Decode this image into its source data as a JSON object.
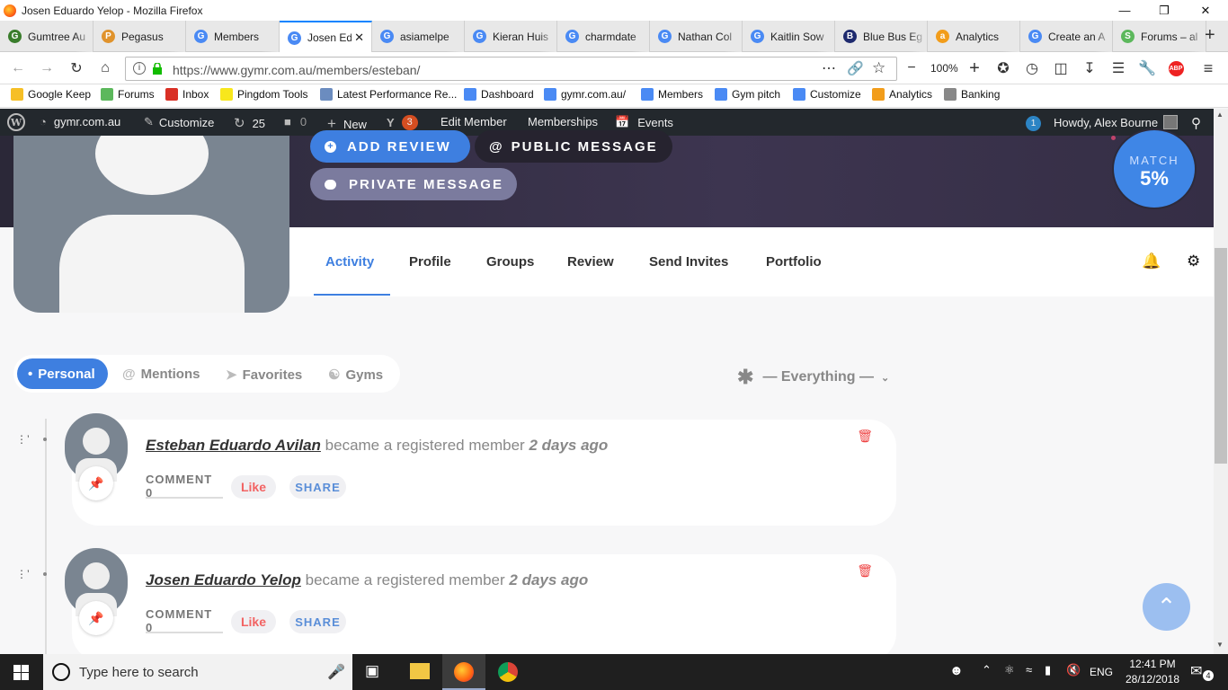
{
  "window": {
    "title": "Josen Eduardo Yelop - Mozilla Firefox",
    "minimize": "—",
    "restore": "❐",
    "close": "✕"
  },
  "tabs": [
    {
      "label": "Gumtree Au",
      "color": "#3a7d2c",
      "glyph": "G"
    },
    {
      "label": "Pegasus",
      "color": "#e0932c",
      "glyph": "P"
    },
    {
      "label": "Members",
      "color": "#4a8af4",
      "glyph": "G"
    },
    {
      "label": "Josen Ed",
      "color": "#4a8af4",
      "glyph": "G",
      "active": true
    },
    {
      "label": "asiamelpe",
      "color": "#4a8af4",
      "glyph": "G"
    },
    {
      "label": "Kieran Huis",
      "color": "#4a8af4",
      "glyph": "G"
    },
    {
      "label": "charmdate",
      "color": "#4a8af4",
      "glyph": "G"
    },
    {
      "label": "Nathan Col",
      "color": "#4a8af4",
      "glyph": "G"
    },
    {
      "label": "Kaitlin Sow",
      "color": "#4a8af4",
      "glyph": "G"
    },
    {
      "label": "Blue Bus Eg",
      "color": "#1e2a6e",
      "glyph": "B"
    },
    {
      "label": "Analytics",
      "color": "#f29d1b",
      "glyph": "a"
    },
    {
      "label": "Create an A",
      "color": "#4a8af4",
      "glyph": "G"
    },
    {
      "label": "Forums – al",
      "color": "#5cb85c",
      "glyph": "S"
    }
  ],
  "new_tab": "+",
  "nav": {
    "url": "https://www.gymr.com.au/members/esteban/",
    "zoom": "100%"
  },
  "bookmarks": [
    {
      "label": "Google Keep",
      "color": "#f6bf26"
    },
    {
      "label": "Forums",
      "color": "#5cb85c"
    },
    {
      "label": "Inbox",
      "color": "#d93025"
    },
    {
      "label": "Pingdom Tools",
      "color": "#f8e71c"
    },
    {
      "label": "Latest Performance Re...",
      "color": "#6b8cbf"
    },
    {
      "label": "Dashboard",
      "color": "#4a8af4"
    },
    {
      "label": "gymr.com.au/",
      "color": "#4a8af4"
    },
    {
      "label": "Members",
      "color": "#4a8af4"
    },
    {
      "label": "Gym pitch",
      "color": "#4a8af4"
    },
    {
      "label": "Customize",
      "color": "#4a8af4"
    },
    {
      "label": "Analytics",
      "color": "#f29d1b"
    },
    {
      "label": "Banking",
      "color": "#888888"
    }
  ],
  "wpbar": {
    "site": "gymr.com.au",
    "customize": "Customize",
    "updates": "25",
    "comments": "0",
    "new": "New",
    "yoast_count": "3",
    "edit_member": "Edit Member",
    "memberships": "Memberships",
    "events": "Events",
    "notif_count": "1",
    "howdy": "Howdy, Alex Bourne"
  },
  "profile": {
    "add_review": "ADD REVIEW",
    "public_message": "PUBLIC MESSAGE",
    "private_message": "PRIVATE MESSAGE",
    "match_label": "MATCH",
    "match_value": "5%"
  },
  "profile_nav": [
    "Activity",
    "Profile",
    "Groups",
    "Review",
    "Send Invites",
    "Portfolio"
  ],
  "filters": {
    "personal": "Personal",
    "mentions": "Mentions",
    "favorites": "Favorites",
    "gyms": "Gyms",
    "everything": "— Everything —"
  },
  "activities": [
    {
      "name": "Esteban Eduardo Avilan",
      "text": "became a registered member",
      "time": "2 days ago",
      "comment": "COMMENT 0",
      "like": "Like",
      "share": "SHARE"
    },
    {
      "name": "Josen Eduardo Yelop",
      "text": "became a registered member",
      "time": "2 days ago",
      "comment": "COMMENT 0",
      "like": "Like",
      "share": "SHARE"
    }
  ],
  "taskbar": {
    "search": "Type here to search",
    "lang": "ENG",
    "time": "12:41 PM",
    "date": "28/12/2018",
    "notif": "4"
  }
}
